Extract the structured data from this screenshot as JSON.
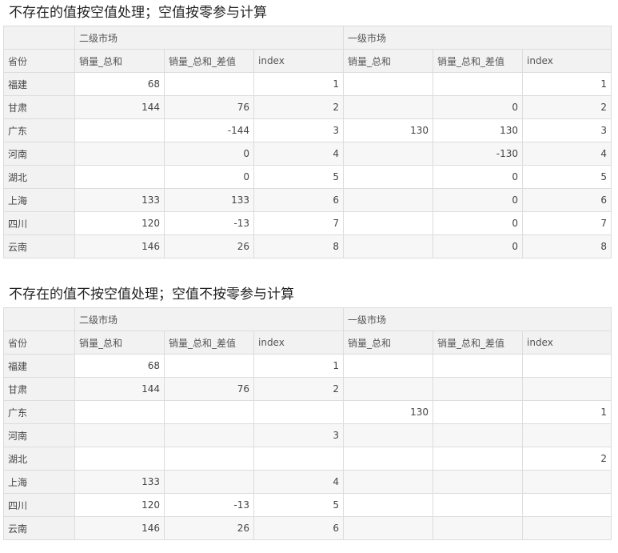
{
  "tables": [
    {
      "title": "不存在的值按空值处理；空值按零参与计算",
      "groups": [
        "二级市场",
        "一级市场"
      ],
      "row_header": "省份",
      "columns": [
        "销量_总和",
        "销量_总和_差值",
        "index",
        "销量_总和",
        "销量_总和_差值",
        "index"
      ],
      "rows": [
        {
          "label": "福建",
          "cells": [
            "68",
            "",
            "1",
            "",
            "",
            "1"
          ]
        },
        {
          "label": "甘肃",
          "cells": [
            "144",
            "76",
            "2",
            "",
            "0",
            "2"
          ]
        },
        {
          "label": "广东",
          "cells": [
            "",
            "-144",
            "3",
            "130",
            "130",
            "3"
          ]
        },
        {
          "label": "河南",
          "cells": [
            "",
            "0",
            "4",
            "",
            "-130",
            "4"
          ]
        },
        {
          "label": "湖北",
          "cells": [
            "",
            "0",
            "5",
            "",
            "0",
            "5"
          ]
        },
        {
          "label": "上海",
          "cells": [
            "133",
            "133",
            "6",
            "",
            "0",
            "6"
          ]
        },
        {
          "label": "四川",
          "cells": [
            "120",
            "-13",
            "7",
            "",
            "0",
            "7"
          ]
        },
        {
          "label": "云南",
          "cells": [
            "146",
            "26",
            "8",
            "",
            "0",
            "8"
          ]
        }
      ]
    },
    {
      "title": "不存在的值不按空值处理；空值不按零参与计算",
      "groups": [
        "二级市场",
        "一级市场"
      ],
      "row_header": "省份",
      "columns": [
        "销量_总和",
        "销量_总和_差值",
        "index",
        "销量_总和",
        "销量_总和_差值",
        "index"
      ],
      "rows": [
        {
          "label": "福建",
          "cells": [
            "68",
            "",
            "1",
            "",
            "",
            ""
          ]
        },
        {
          "label": "甘肃",
          "cells": [
            "144",
            "76",
            "2",
            "",
            "",
            ""
          ]
        },
        {
          "label": "广东",
          "cells": [
            "",
            "",
            "",
            "130",
            "",
            "1"
          ]
        },
        {
          "label": "河南",
          "cells": [
            "",
            "",
            "3",
            "",
            "",
            ""
          ]
        },
        {
          "label": "湖北",
          "cells": [
            "",
            "",
            "",
            "",
            "",
            "2"
          ]
        },
        {
          "label": "上海",
          "cells": [
            "133",
            "",
            "4",
            "",
            "",
            ""
          ]
        },
        {
          "label": "四川",
          "cells": [
            "120",
            "-13",
            "5",
            "",
            "",
            ""
          ]
        },
        {
          "label": "云南",
          "cells": [
            "146",
            "26",
            "6",
            "",
            "",
            ""
          ]
        }
      ]
    }
  ]
}
